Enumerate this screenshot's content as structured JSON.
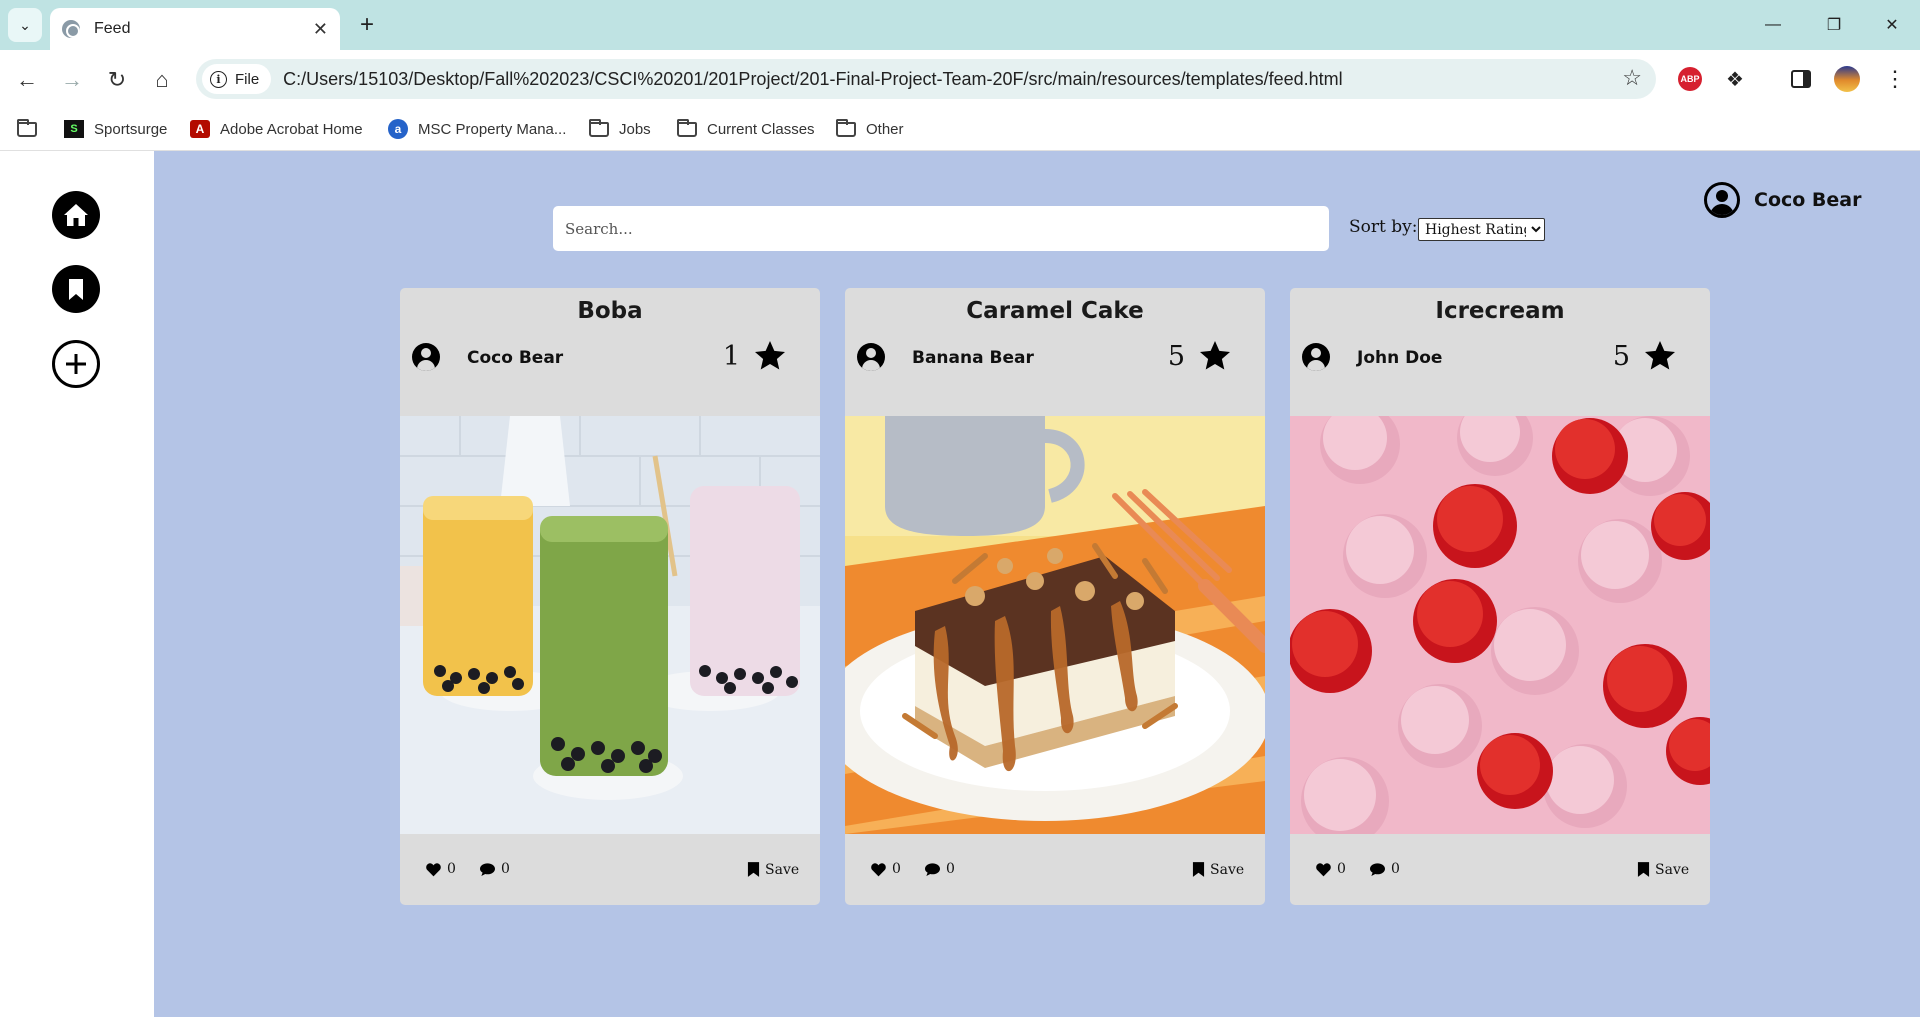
{
  "browser": {
    "tab_title": "Feed",
    "url_chip": "File",
    "url": "C:/Users/15103/Desktop/Fall%202023/CSCI%20201/201Project/201-Final-Project-Team-20F/src/main/resources/templates/feed.html",
    "abp_label": "ABP",
    "bookmarks": [
      "Sportsurge",
      "Adobe Acrobat Home",
      "MSC Property Mana...",
      "Jobs",
      "Current Classes",
      "Other"
    ]
  },
  "header": {
    "search_placeholder": "Search...",
    "sort_label": "Sort by:",
    "sort_selected": "Highest Rating",
    "current_user": "Coco Bear"
  },
  "sidebar": {
    "items": [
      "home-icon",
      "bookmark-icon",
      "add-icon"
    ]
  },
  "posts": [
    {
      "title": "Boba",
      "author": "Coco Bear",
      "rating": "1",
      "likes": "0",
      "comments": "0",
      "save_label": "Save",
      "image": "boba drinks"
    },
    {
      "title": "Caramel Cake",
      "author": "Banana Bear",
      "rating": "5",
      "likes": "0",
      "comments": "0",
      "save_label": "Save",
      "image": "caramel cake slice"
    },
    {
      "title": "Icrecream",
      "author": "John Doe",
      "rating": "5",
      "likes": "0",
      "comments": "0",
      "save_label": "Save",
      "image": "ice cream scoops"
    }
  ]
}
